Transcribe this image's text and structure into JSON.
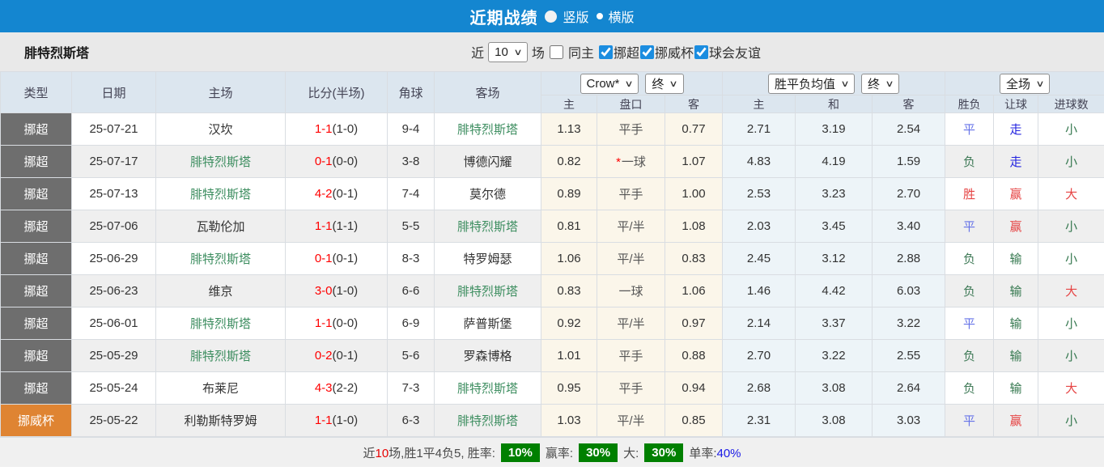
{
  "colors": {
    "topbar": "#1486d0",
    "checkbox_accent": "#1b8de0",
    "type_badge": {
      "挪超": "#6e6e6e",
      "挪威杯": "#df8432"
    },
    "team_highlight": "#3c8d5f",
    "score_red": "#ff0000",
    "status": {
      "胜": "#e64444",
      "赢": "#e64444",
      "大": "#e64444",
      "平": "#6673e8",
      "走": "#2424e0",
      "负": "#3f7a57",
      "输": "#35784f",
      "小": "#35784f"
    },
    "badge_green": "#008000"
  },
  "title_bar": {
    "title": "近期战绩",
    "option_vertical": "竖版",
    "option_horizontal": "横版"
  },
  "filter_bar": {
    "team_name": "腓特烈斯塔",
    "recent_label": "近",
    "recent_value": "10",
    "matches_label": "场",
    "same_home_label": "同主",
    "same_home_checked": false,
    "leagues": [
      {
        "label": "挪超",
        "checked": true
      },
      {
        "label": "挪威杯",
        "checked": true
      },
      {
        "label": "球会友谊",
        "checked": true
      }
    ]
  },
  "table": {
    "dropdowns": {
      "bookmaker": "Crow*",
      "bookmaker_time": "终",
      "avg": "胜平负均值",
      "avg_time": "终",
      "period": "全场"
    },
    "headers": {
      "type": "类型",
      "date": "日期",
      "home": "主场",
      "score": "比分(半场)",
      "corner": "角球",
      "away": "客场",
      "odds_home": "主",
      "odds_line": "盘口",
      "odds_away": "客",
      "avg_home": "主",
      "avg_draw": "和",
      "avg_away": "客",
      "result": "胜负",
      "handicap": "让球",
      "goals": "进球数"
    },
    "rows": [
      {
        "type": "挪超",
        "date": "25-07-21",
        "home": "汉坎",
        "score": "1-1",
        "half": "(1-0)",
        "corners": "9-4",
        "away": "腓特烈斯塔",
        "odds_home": "1.13",
        "line": "平手",
        "line_star": false,
        "odds_away": "0.77",
        "avg_home": "2.71",
        "avg_draw": "3.19",
        "avg_away": "2.54",
        "result": "平",
        "handicap": "走",
        "goals": "小"
      },
      {
        "type": "挪超",
        "date": "25-07-17",
        "home": "腓特烈斯塔",
        "score": "0-1",
        "half": "(0-0)",
        "corners": "3-8",
        "away": "博德闪耀",
        "odds_home": "0.82",
        "line": "一球",
        "line_star": true,
        "odds_away": "1.07",
        "avg_home": "4.83",
        "avg_draw": "4.19",
        "avg_away": "1.59",
        "result": "负",
        "handicap": "走",
        "goals": "小"
      },
      {
        "type": "挪超",
        "date": "25-07-13",
        "home": "腓特烈斯塔",
        "score": "4-2",
        "half": "(0-1)",
        "corners": "7-4",
        "away": "莫尔德",
        "odds_home": "0.89",
        "line": "平手",
        "line_star": false,
        "odds_away": "1.00",
        "avg_home": "2.53",
        "avg_draw": "3.23",
        "avg_away": "2.70",
        "result": "胜",
        "handicap": "赢",
        "goals": "大"
      },
      {
        "type": "挪超",
        "date": "25-07-06",
        "home": "瓦勒伦加",
        "score": "1-1",
        "half": "(1-1)",
        "corners": "5-5",
        "away": "腓特烈斯塔",
        "odds_home": "0.81",
        "line": "平/半",
        "line_star": false,
        "odds_away": "1.08",
        "avg_home": "2.03",
        "avg_draw": "3.45",
        "avg_away": "3.40",
        "result": "平",
        "handicap": "赢",
        "goals": "小"
      },
      {
        "type": "挪超",
        "date": "25-06-29",
        "home": "腓特烈斯塔",
        "score": "0-1",
        "half": "(0-1)",
        "corners": "8-3",
        "away": "特罗姆瑟",
        "odds_home": "1.06",
        "line": "平/半",
        "line_star": false,
        "odds_away": "0.83",
        "avg_home": "2.45",
        "avg_draw": "3.12",
        "avg_away": "2.88",
        "result": "负",
        "handicap": "输",
        "goals": "小"
      },
      {
        "type": "挪超",
        "date": "25-06-23",
        "home": "维京",
        "score": "3-0",
        "half": "(1-0)",
        "corners": "6-6",
        "away": "腓特烈斯塔",
        "odds_home": "0.83",
        "line": "一球",
        "line_star": false,
        "odds_away": "1.06",
        "avg_home": "1.46",
        "avg_draw": "4.42",
        "avg_away": "6.03",
        "result": "负",
        "handicap": "输",
        "goals": "大"
      },
      {
        "type": "挪超",
        "date": "25-06-01",
        "home": "腓特烈斯塔",
        "score": "1-1",
        "half": "(0-0)",
        "corners": "6-9",
        "away": "萨普斯堡",
        "odds_home": "0.92",
        "line": "平/半",
        "line_star": false,
        "odds_away": "0.97",
        "avg_home": "2.14",
        "avg_draw": "3.37",
        "avg_away": "3.22",
        "result": "平",
        "handicap": "输",
        "goals": "小"
      },
      {
        "type": "挪超",
        "date": "25-05-29",
        "home": "腓特烈斯塔",
        "score": "0-2",
        "half": "(0-1)",
        "corners": "5-6",
        "away": "罗森博格",
        "odds_home": "1.01",
        "line": "平手",
        "line_star": false,
        "odds_away": "0.88",
        "avg_home": "2.70",
        "avg_draw": "3.22",
        "avg_away": "2.55",
        "result": "负",
        "handicap": "输",
        "goals": "小"
      },
      {
        "type": "挪超",
        "date": "25-05-24",
        "home": "布莱尼",
        "score": "4-3",
        "half": "(2-2)",
        "corners": "7-3",
        "away": "腓特烈斯塔",
        "odds_home": "0.95",
        "line": "平手",
        "line_star": false,
        "odds_away": "0.94",
        "avg_home": "2.68",
        "avg_draw": "3.08",
        "avg_away": "2.64",
        "result": "负",
        "handicap": "输",
        "goals": "大"
      },
      {
        "type": "挪威杯",
        "date": "25-05-22",
        "home": "利勒斯特罗姆",
        "score": "1-1",
        "half": "(1-0)",
        "corners": "6-3",
        "away": "腓特烈斯塔",
        "odds_home": "1.03",
        "line": "平/半",
        "line_star": false,
        "odds_away": "0.85",
        "avg_home": "2.31",
        "avg_draw": "3.08",
        "avg_away": "3.03",
        "result": "平",
        "handicap": "赢",
        "goals": "小"
      }
    ]
  },
  "summary": {
    "recent_label": "近",
    "recent_count": "10",
    "record_text": "场,胜1平4负5, 胜率:",
    "win_rate": "10%",
    "odds_win_label": "赢率:",
    "odds_win_rate": "30%",
    "big_label": "大:",
    "big_rate": "30%",
    "single_label": "单率:",
    "single_rate": "40%"
  }
}
